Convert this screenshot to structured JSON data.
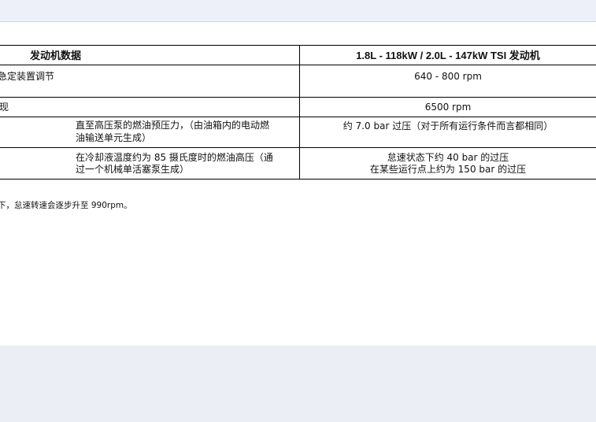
{
  "table": {
    "header": {
      "col1": "发动机数据",
      "col2": "1.8L - 118kW / 2.0L - 147kW TSI 发动机"
    },
    "rows": [
      {
        "label": "急定装置调节",
        "value": "640 - 800 rpm"
      },
      {
        "label": "现",
        "value": "6500 rpm"
      },
      {
        "label_line1": "直至高压泵的燃油预压力，（由油箱内的电动燃",
        "label_line2": "油输送单元生成）",
        "value": "约 7.0 bar 过压（对于所有运行条件而言都相同）"
      },
      {
        "label_line1": "在冷却液温度约为 85 摄氏度时的燃油高压（通",
        "label_line2": "过一个机械单活塞泵生成）",
        "value_line1": "怠速状态下约 40 bar 的过压",
        "value_line2": "在某些运行点上约为 150 bar 的过压"
      }
    ]
  },
  "footnote": "下，怠速转速会逐步升至 990rpm。"
}
